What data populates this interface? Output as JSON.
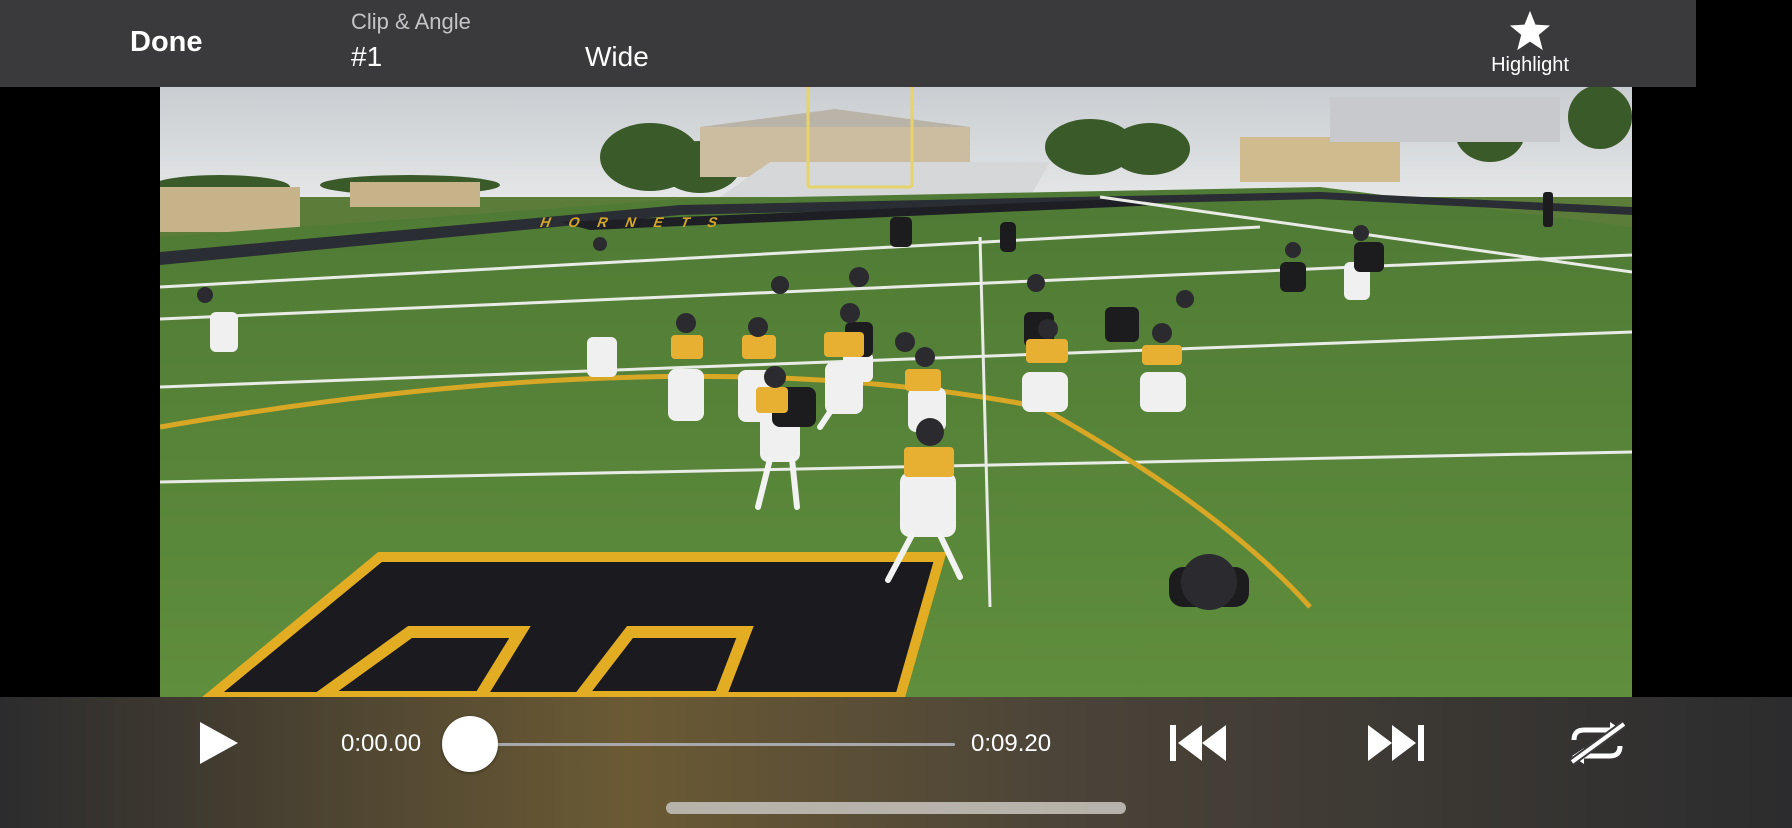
{
  "top_bar": {
    "done_label": "Done",
    "clip_angle_label": "Clip & Angle",
    "clip_number": "#1",
    "angle_name": "Wide",
    "highlight_label": "Highlight"
  },
  "video": {
    "description_icon": "football-practice-video-frame",
    "end_zone_letters": "HORNETS"
  },
  "controls": {
    "current_time": "0:00.00",
    "total_time": "0:09.20",
    "progress": 0.0,
    "icons": {
      "play": "play-icon",
      "skip_back": "skip-back-icon",
      "skip_forward": "skip-forward-icon",
      "loop": "loop-off-icon",
      "highlight": "star-icon"
    }
  }
}
